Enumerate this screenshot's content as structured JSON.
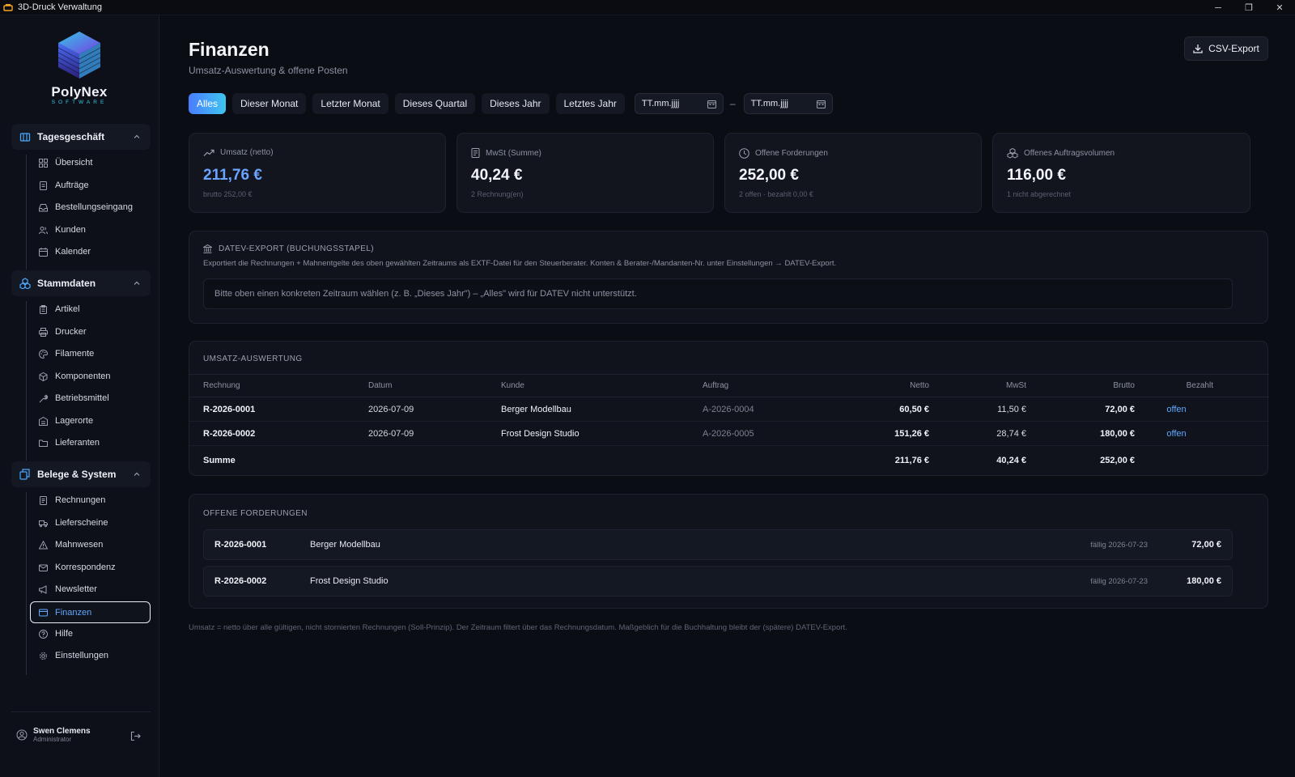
{
  "window": {
    "title": "3D-Druck Verwaltung",
    "minimize": "─",
    "maximize": "❐",
    "close": "✕"
  },
  "sidebar": {
    "brand": "PolyNex",
    "brand_sub": "SOFTWARE",
    "groups": [
      {
        "label": "Tagesgeschäft",
        "items": [
          "Übersicht",
          "Aufträge",
          "Bestellungseingang",
          "Kunden",
          "Kalender"
        ]
      },
      {
        "label": "Stammdaten",
        "items": [
          "Artikel",
          "Drucker",
          "Filamente",
          "Komponenten",
          "Betriebsmittel",
          "Lagerorte",
          "Lieferanten"
        ]
      },
      {
        "label": "Belege & System",
        "items": [
          "Rechnungen",
          "Lieferscheine",
          "Mahnwesen",
          "Korrespondenz",
          "Newsletter",
          "Finanzen",
          "Hilfe",
          "Einstellungen"
        ]
      }
    ],
    "active_item": "Finanzen",
    "user": {
      "name": "Swen Clemens",
      "role": "Administrator"
    }
  },
  "header": {
    "title": "Finanzen",
    "subtitle": "Umsatz-Auswertung & offene Posten",
    "csv_label": "CSV-Export"
  },
  "filters": {
    "chips": [
      "Alles",
      "Dieser Monat",
      "Letzter Monat",
      "Dieses Quartal",
      "Dieses Jahr",
      "Letztes Jahr"
    ],
    "active": "Alles",
    "from_placeholder": "TT.mm.jjjj",
    "to_placeholder": "TT.mm.jjjj",
    "separator": "–"
  },
  "cards": [
    {
      "label": "Umsatz (netto)",
      "value": "211,76 €",
      "sub": "brutto 252,00 €",
      "icon": "trend-up-icon"
    },
    {
      "label": "MwSt (Summe)",
      "value": "40,24 €",
      "sub": "2 Rechnung(en)",
      "icon": "receipt-icon"
    },
    {
      "label": "Offene Forderungen",
      "value": "252,00 €",
      "sub": "2 offen · bezahlt 0,00 €",
      "icon": "clock-icon"
    },
    {
      "label": "Offenes Auftragsvolumen",
      "value": "116,00 €",
      "sub": "1 nicht abgerechnet",
      "icon": "boxes-icon"
    }
  ],
  "datev": {
    "title": "DATEV-EXPORT (BUCHUNGSSTAPEL)",
    "description": "Exportiert die Rechnungen + Mahnentgelte des oben gewählten Zeitraums als EXTF-Datei für den Steuerberater. Konten & Berater-/Mandanten-Nr. unter Einstellungen → DATEV-Export.",
    "note": "Bitte oben einen konkreten Zeitraum wählen (z. B. „Dieses Jahr\") – „Alles\" wird für DATEV nicht unterstützt."
  },
  "revenue": {
    "title": "UMSATZ-AUSWERTUNG",
    "columns": [
      "Rechnung",
      "Datum",
      "Kunde",
      "Auftrag",
      "Netto",
      "MwSt",
      "Brutto",
      "Bezahlt"
    ],
    "rows": [
      {
        "invoice": "R-2026-0001",
        "date": "2026-07-09",
        "customer": "Berger Modellbau",
        "order": "A-2026-0004",
        "net": "60,50 €",
        "vat": "11,50 €",
        "gross": "72,00 €",
        "paid": "offen"
      },
      {
        "invoice": "R-2026-0002",
        "date": "2026-07-09",
        "customer": "Frost Design Studio",
        "order": "A-2026-0005",
        "net": "151,26 €",
        "vat": "28,74 €",
        "gross": "180,00 €",
        "paid": "offen"
      }
    ],
    "sum": {
      "label": "Summe",
      "net": "211,76 €",
      "vat": "40,24 €",
      "gross": "252,00 €"
    }
  },
  "open_items": {
    "title": "OFFENE FORDERUNGEN",
    "rows": [
      {
        "invoice": "R-2026-0001",
        "customer": "Berger Modellbau",
        "due": "fällig 2026-07-23",
        "amount": "72,00 €"
      },
      {
        "invoice": "R-2026-0002",
        "customer": "Frost Design Studio",
        "due": "fällig 2026-07-23",
        "amount": "180,00 €"
      }
    ]
  },
  "footnote": "Umsatz = netto über alle gültigen, nicht stornierten Rechnungen (Soll-Prinzip). Der Zeitraum filtert über das Rechnungsdatum. Maßgeblich für die Buchhaltung bleibt der (spätere) DATEV-Export.",
  "colors": {
    "accent": "#5fa8ff",
    "background": "#0b0d14",
    "card": "#12151e"
  }
}
